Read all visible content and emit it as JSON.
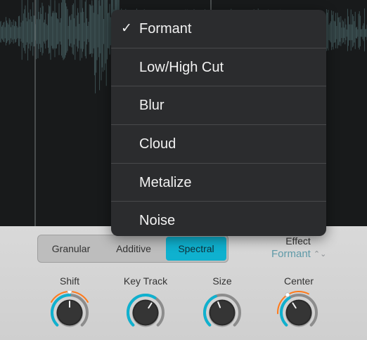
{
  "menu": {
    "items": [
      {
        "label": "Formant",
        "checked": true
      },
      {
        "label": "Low/High Cut",
        "checked": false
      },
      {
        "label": "Blur",
        "checked": false
      },
      {
        "label": "Cloud",
        "checked": false
      },
      {
        "label": "Metalize",
        "checked": false
      },
      {
        "label": "Noise",
        "checked": false
      }
    ],
    "check_glyph": "✓"
  },
  "mode_selector": {
    "options": [
      "Granular",
      "Additive",
      "Spectral"
    ],
    "selected": "Spectral"
  },
  "effect": {
    "label": "Effect",
    "value": "Formant",
    "chevron": "⌃⌄"
  },
  "knobs": [
    {
      "label": "Shift",
      "value": 0.5,
      "has_modulation": true
    },
    {
      "label": "Key Track",
      "value": 0.62,
      "has_modulation": false
    },
    {
      "label": "Size",
      "value": 0.42,
      "has_modulation": false
    },
    {
      "label": "Center",
      "value": 0.38,
      "has_modulation": true
    }
  ],
  "colors": {
    "accent": "#0fb1cf",
    "modulation": "#ff7a1a",
    "menu_bg": "#2b2c2e",
    "panel_bg": "#d6d6d6"
  }
}
